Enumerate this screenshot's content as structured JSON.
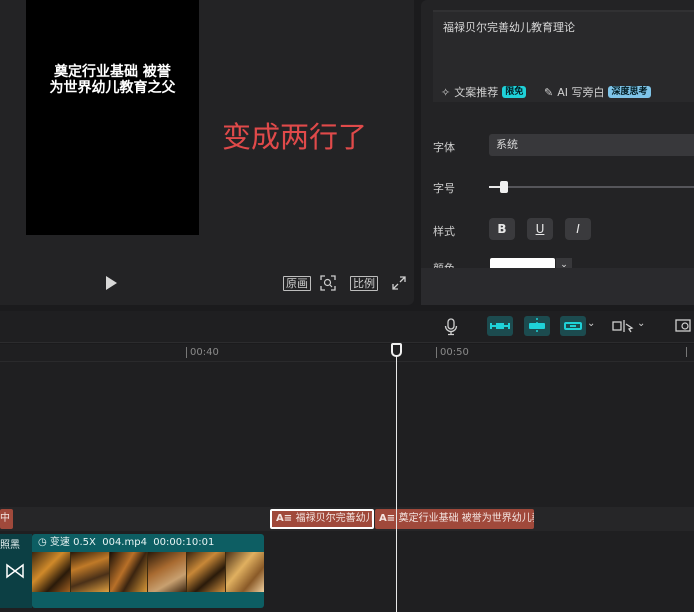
{
  "preview": {
    "subtitle_line1": "奠定行业基础 被誉",
    "subtitle_line2": "为世界幼儿教育之父",
    "annotation": "变成两行了",
    "controls": {
      "original": "原画",
      "ratio": "比例"
    }
  },
  "inspector": {
    "text_value": "福禄贝尔完善幼儿教育理论",
    "ai_copy_label": "文案推荐",
    "ai_copy_tag": "限免",
    "ai_write_label": "AI 写旁白",
    "ai_write_tag": "深度思考",
    "font_label": "字体",
    "font_value": "系统",
    "size_label": "字号",
    "size_value": 0.07,
    "style_label": "样式",
    "style_bold": "B",
    "style_underline": "U",
    "style_italic": "I",
    "color_label": "颜色"
  },
  "timeline": {
    "tick_40": "00:40",
    "tick_50": "00:50",
    "left_text_clip": "中",
    "text_clip_1": "福禄贝尔完善幼儿",
    "text_clip_2": "奠定行业基础 被誉为世界幼儿教",
    "left_video_label": "照黑",
    "video_speed": "变速 0.5X",
    "video_name": "004.mp4",
    "video_duration": "00:00:10:01"
  },
  "colors": {
    "accent": "#1fd1d8",
    "text_clip": "#a0493b",
    "video_clip": "#0d5e63",
    "annotation": "#e04a4a"
  }
}
